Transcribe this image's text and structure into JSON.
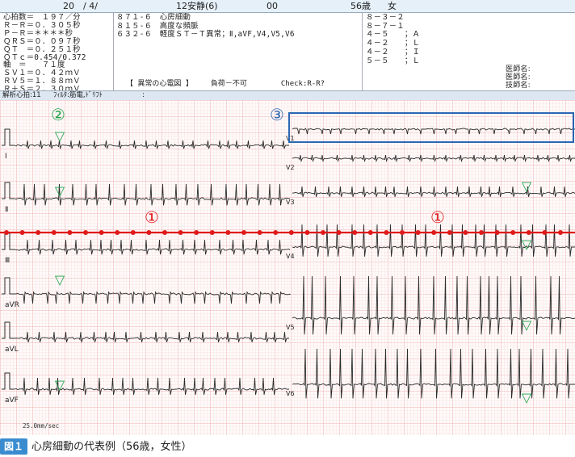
{
  "header": {
    "date": "20　/ 4/",
    "condition": "12安静(6)",
    "code": "00",
    "age": "56歳",
    "sex": "女"
  },
  "measurements": [
    "心拍数＝　１９７／分",
    "Ｒ－Ｒ＝０．３０５秒",
    "Ｐ－Ｒ＝＊＊＊＊秒",
    "ＱＲＳ＝０．０９７秒",
    "ＱＴ　＝０．２５１秒",
    "ＱＴｃ＝0.454/0.372",
    "軸　＝　　７１度",
    "ＳＶ１＝０．４２ｍＶ",
    "ＲＶ５＝１．８８ｍＶ",
    "Ｒ＋Ｓ＝２．３０ｍＶ"
  ],
  "findings": [
    "８７１-６　心房細動",
    "８１５-６　高度な頻脈",
    "６３２-６　軽度ＳＴ－Ｔ異常；Ⅱ,aVF,V4,V5,V6"
  ],
  "summary": {
    "result": "【 異常の心電図 】",
    "load": "負荷－不可",
    "check": "Check:R-R?"
  },
  "codes": [
    "８－３－２",
    "８－７－１",
    "４－５　　；Ａ",
    "４－２　　；Ｌ",
    "４－２　　；Ｉ",
    "５－５　　；Ｌ"
  ],
  "signatures": [
    "医師名:",
    "医師名:",
    "技師名:"
  ],
  "status": {
    "analysis": "解析心拍:11",
    "filter": "ﾌｨﾙﾀ:筋電,ﾄﾞﾘﾌﾄ",
    "colon": ":"
  },
  "lead_labels": {
    "left": [
      "Ⅰ",
      "Ⅱ",
      "Ⅲ",
      "aVR",
      "aVL",
      "aVF"
    ],
    "right": [
      "V1",
      "V2",
      "V3",
      "V4",
      "V5",
      "V6"
    ]
  },
  "annotations": {
    "marker1": "①",
    "marker2": "②",
    "marker3": "③",
    "triangle": "▽"
  },
  "paper_speed": "25.0mm/sec",
  "caption": {
    "badge": "図１",
    "text": "心房細動の代表例（56歳，女性）"
  },
  "colors": {
    "grid_minor": "#f6d2d2",
    "grid_major": "#eba3a3",
    "trace": "#2b2b2b",
    "red_line": "#e01a1a",
    "green": "#1fa34a",
    "blue": "#2b67b2",
    "caption_badge": "#3a8ccf"
  }
}
